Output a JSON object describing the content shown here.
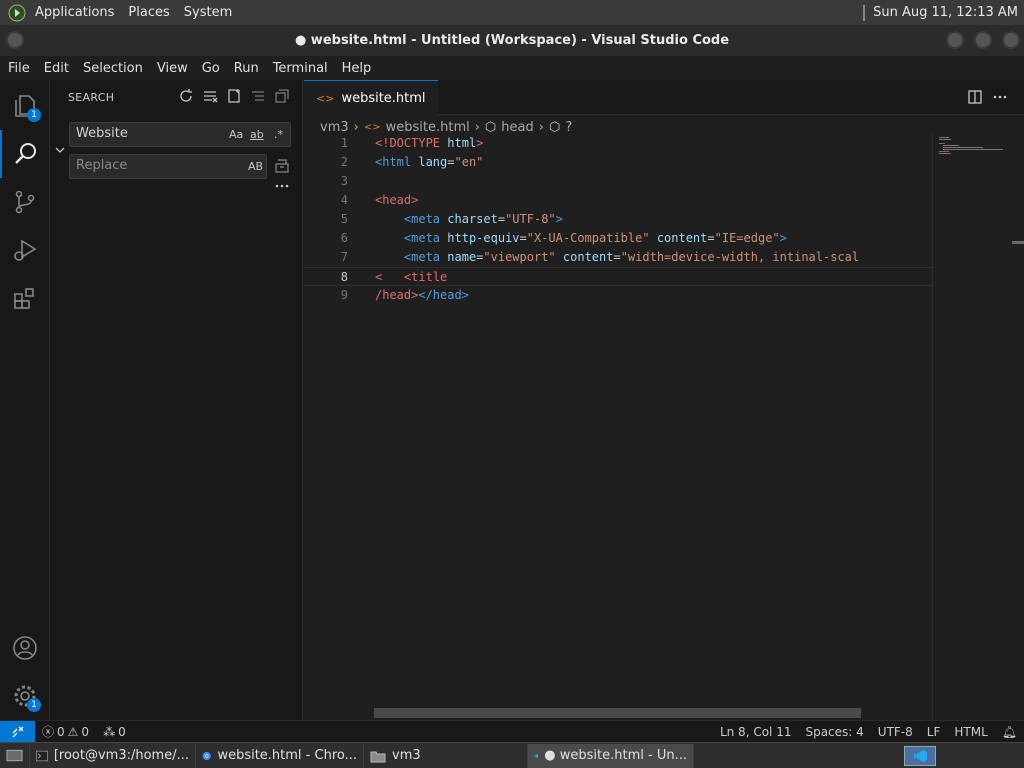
{
  "topbar": {
    "menus": [
      "Applications",
      "Places",
      "System"
    ],
    "clock": "Sun Aug 11, 12:13 AM"
  },
  "window": {
    "title": "● website.html - Untitled (Workspace) - Visual Studio Code"
  },
  "menubar": [
    "File",
    "Edit",
    "Selection",
    "View",
    "Go",
    "Run",
    "Terminal",
    "Help"
  ],
  "activity": {
    "explorer_badge": "1",
    "settings_badge": "1"
  },
  "sidebar": {
    "title": "SEARCH",
    "search_value": "Website",
    "replace_placeholder": "Replace",
    "opt_case": "Aa",
    "opt_word": "ab",
    "opt_regex": ".*",
    "opt_preserve": "AB"
  },
  "editor": {
    "tab_label": "website.html",
    "breadcrumb": [
      "vm3",
      "website.html",
      "head",
      "?"
    ],
    "line_numbers": [
      "1",
      "2",
      "3",
      "4",
      "5",
      "6",
      "7",
      "8",
      "9"
    ]
  },
  "statusbar": {
    "errors": "0",
    "warnings": "0",
    "ports": "0",
    "position": "Ln 8, Col 11",
    "spaces": "Spaces: 4",
    "encoding": "UTF-8",
    "eol": "LF",
    "language": "HTML"
  },
  "taskbar": [
    {
      "label": "[root@vm3:/home/..."
    },
    {
      "label": "website.html - Chro..."
    },
    {
      "label": "vm3"
    },
    {
      "label": "● website.html - Un..."
    }
  ],
  "colors": {
    "accent": "#0078d4",
    "tag_red": "#e06c6c",
    "string": "#ce9178",
    "attr": "#9cdcfe"
  }
}
